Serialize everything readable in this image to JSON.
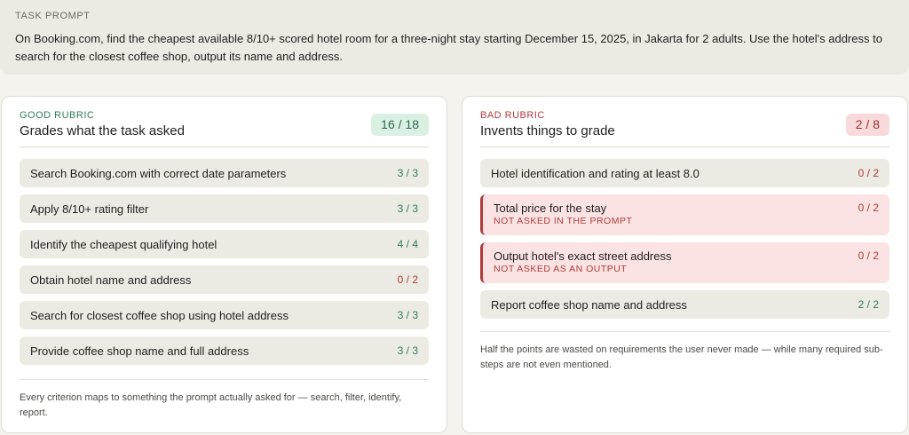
{
  "task": {
    "label": "TASK PROMPT",
    "text": "On Booking.com, find the cheapest available 8/10+ scored hotel room for a three-night stay starting December 15, 2025, in Jakarta for 2 adults. Use the hotel's address to search for the closest coffee shop, output its name and address."
  },
  "good": {
    "kind": "GOOD RUBRIC",
    "title": "Grades what the task asked",
    "score": "16 / 18",
    "items": [
      {
        "label": "Search Booking.com with correct date parameters",
        "points": "3 / 3"
      },
      {
        "label": "Apply 8/10+ rating filter",
        "points": "3 / 3"
      },
      {
        "label": "Identify the cheapest qualifying hotel",
        "points": "4 / 4"
      },
      {
        "label": "Obtain hotel name and address",
        "points": "0 / 2"
      },
      {
        "label": "Search for closest coffee shop using hotel address",
        "points": "3 / 3"
      },
      {
        "label": "Provide coffee shop name and full address",
        "points": "3 / 3"
      }
    ],
    "footnote": "Every criterion maps to something the prompt actually asked for — search, filter, identify, report."
  },
  "bad": {
    "kind": "BAD RUBRIC",
    "title": "Invents things to grade",
    "score": "2 / 8",
    "items": [
      {
        "label": "Hotel identification and rating at least 8.0",
        "points": "0 / 2",
        "note": ""
      },
      {
        "label": "Total price for the stay",
        "points": "0 / 2",
        "note": "NOT ASKED IN THE PROMPT"
      },
      {
        "label": "Output hotel's exact street address",
        "points": "0 / 2",
        "note": "NOT ASKED AS AN OUTPUT"
      },
      {
        "label": "Report coffee shop name and address",
        "points": "2 / 2",
        "note": ""
      }
    ],
    "footnote": "Half the points are wasted on requirements the user never made — while many required sub-steps are not even mentioned."
  },
  "colors": {
    "good_accent": "#2e7d5b",
    "bad_accent": "#b23a3a"
  }
}
